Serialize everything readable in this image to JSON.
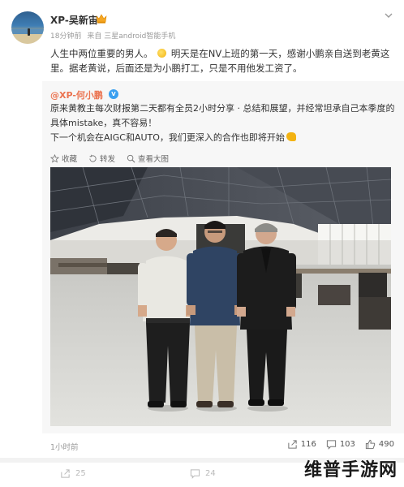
{
  "header": {
    "username": "XP-吴新宙",
    "time": "18分钟前",
    "source": "来自 三星android智能手机",
    "post_text_1": "人生中两位重要的男人。",
    "post_text_2": "明天是在NV上班的第一天，感谢小鹏亲自送到老黄这里。据老黄说，后面还是为小鹏打工，只是不用他发工资了。",
    "icons": {
      "crown": "crown-icon",
      "menu": "chevron-down-icon"
    }
  },
  "repost": {
    "username": "@XP-何小鹏",
    "badge": "V",
    "text_1": "原来黄教主每次财报第二天都有全员2小时分享 · 总结和展望，并经常坦承自己本季度的具体mistake，真不容易！",
    "text_2": "下一个机会在AIGC和AUTO，我们更深入的合作也即将开始",
    "actions": {
      "favorite": "收藏",
      "forward": "转发",
      "view_large": "查看大图"
    }
  },
  "footer": {
    "time": "1小时前",
    "share_count": "116",
    "comment_count": "103",
    "like_count": "490"
  },
  "bottom_bar": {
    "share_count": "25",
    "comment_count": "24"
  },
  "watermark": "维普手游网",
  "colors": {
    "repost_user": "#eb7350",
    "badge": "#3aa0f0",
    "card_bg": "#f7f7f7"
  }
}
